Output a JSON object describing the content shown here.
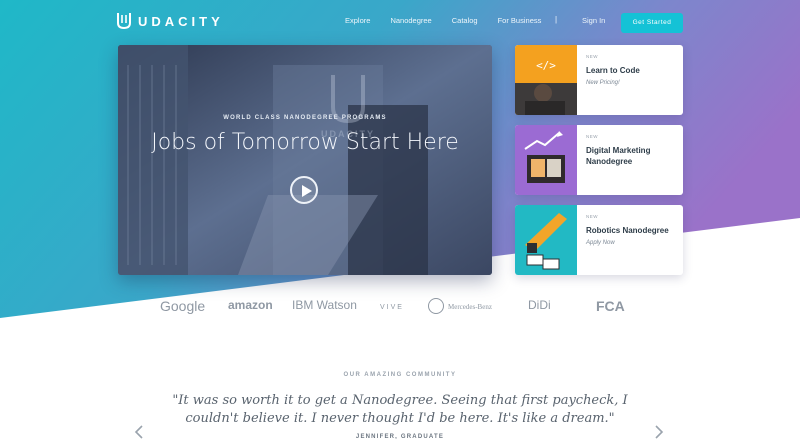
{
  "brand": {
    "name": "UDACITY"
  },
  "nav": {
    "links": [
      "Explore",
      "Nanodegree",
      "Catalog",
      "For Business"
    ],
    "separator": "|",
    "signin": "Sign In",
    "cta": "Get Started"
  },
  "hero": {
    "eyebrow": "WORLD CLASS NANODEGREE PROGRAMS",
    "title": "Jobs of Tomorrow Start Here"
  },
  "cards": [
    {
      "eyebrow": "NEW",
      "title": "Learn to Code",
      "subtitle": "New Pricing!",
      "icon": "code-icon"
    },
    {
      "eyebrow": "NEW",
      "title": "Digital Marketing Nanodegree",
      "subtitle": "",
      "icon": "chart-growth-icon"
    },
    {
      "eyebrow": "NEW",
      "title": "Robotics Nanodegree",
      "subtitle": "Apply Now",
      "icon": "robot-arm-icon"
    }
  ],
  "partners": [
    "Google",
    "amazon",
    "IBM Watson",
    "VIVE",
    "Mercedes-Benz",
    "DiDi",
    "FCA"
  ],
  "community": {
    "heading": "OUR AMAZING COMMUNITY",
    "quote": "\"It was so worth it to get a Nanodegree. Seeing that first paycheck, I couldn't believe it. I never thought I'd be here. It's like a dream.\"",
    "author": "JENNIFER, GRADUATE"
  },
  "colors": {
    "teal": "#1fb8c8",
    "purple": "#8d74c7",
    "cta": "#14c2d6",
    "card_orange": "#f4a11f",
    "card_purple": "#9b6bd3",
    "card_teal": "#22b9c4"
  }
}
